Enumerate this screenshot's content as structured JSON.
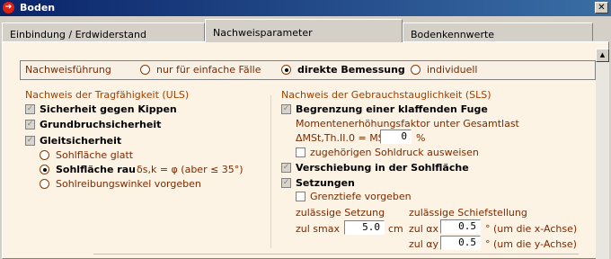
{
  "window": {
    "title": "Boden",
    "close_label": "✕"
  },
  "tabs": [
    {
      "label": "Einbindung / Erdwiderstand"
    },
    {
      "label": "Nachweisparameter"
    },
    {
      "label": "Bodenkennwerte"
    }
  ],
  "method": {
    "label": "Nachweisführung",
    "options": [
      "nur für einfache Fälle",
      "direkte Bemessung",
      "individuell"
    ],
    "selected": "direkte Bemessung"
  },
  "uls": {
    "title": "Nachweis der Tragfähigkeit (ULS)",
    "kippen": {
      "label": "Sicherheit gegen Kippen",
      "checked": true
    },
    "grundbruch": {
      "label": "Grundbruchsicherheit",
      "checked": true
    },
    "gleit": {
      "label": "Gleitsicherheit",
      "checked": true
    },
    "sohl_options": [
      {
        "label": "Sohlfläche glatt",
        "selected": false
      },
      {
        "label": "Sohlfläche rau",
        "selected": true,
        "formula": "δs,k = φ (aber ≤ 35°)"
      },
      {
        "label": "Sohlreibungswinkel vorgeben",
        "selected": false
      }
    ]
  },
  "sls": {
    "title": "Nachweis der Gebrauchstauglichkeit (SLS)",
    "fuge": {
      "label": "Begrenzung einer klaffenden Fuge",
      "checked": true
    },
    "moment_text": "Momentenerhöhungsfaktor unter Gesamtlast",
    "delta_label": "ΔMSt,Th.II.0 = MSt ×",
    "delta_value": "0",
    "delta_unit": "%",
    "sohldruck": {
      "label": "zugehörigen Sohldruck ausweisen",
      "checked": false
    },
    "verschiebung": {
      "label": "Verschiebung in der Sohlfläche",
      "checked": true
    },
    "setzungen": {
      "label": "Setzungen",
      "checked": true
    },
    "grenztiefe": {
      "label": "Grenztiefe vorgeben",
      "checked": false
    },
    "setzung_title": "zulässige Setzung",
    "smax_label": "zul smax",
    "smax_value": "5.0",
    "smax_unit": "cm",
    "schief_title": "zulässige Schiefstellung",
    "ax_label": "zul αx",
    "ax_value": "0.5",
    "ax_unit": "° (um die x-Achse)",
    "ay_label": "zul αy",
    "ay_value": "0.5",
    "ay_unit": "° (um die y-Achse)"
  }
}
